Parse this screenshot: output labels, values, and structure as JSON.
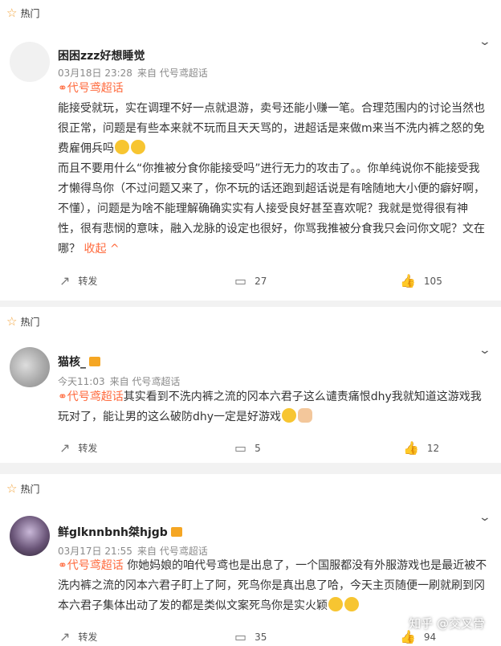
{
  "posts": [
    {
      "hot_label": "热门",
      "username": "困困zzz好想睡觉",
      "date": "03月18日 23:28",
      "source": "来自 代号鸢超话",
      "topic": "代号鸢超话",
      "text1": "能接受就玩，实在调理不好一点就退游，卖号还能小赚一笔。合理范围内的讨论当然也很正常，问题是有些本来就不玩而且天天骂的，进超话是来做m来当不洗内裤之怒的免费雇佣兵吗",
      "text2": "而且不要用什么“你推被分食你能接受吗”进行无力的攻击了。。你单纯说你不能接受我才懒得鸟你（不过问题又来了，你不玩的话还跑到超话说是有啥随地大小便的癖好啊，不懂），问题是为啥不能理解确确实实有人接受良好甚至喜欢呢？我就是觉得很有神性，很有悲悯的意味，融入龙脉的设定也很好，你骂我推被分食我只会问你文呢？文在哪？",
      "fold": "收起",
      "repost": "转发",
      "comments": "27",
      "likes": "105"
    },
    {
      "hot_label": "热门",
      "username": "猫核_",
      "date": "今天11:03",
      "source": "来自 代号鸢超话",
      "topic": "代号鸢超话",
      "text1": "其实看到不洗内裤之流的冈本六君子这么谴责痛恨dhy我就知道这游戏我玩对了，能让男的这么破防dhy一定是好游戏",
      "repost": "转发",
      "comments": "5",
      "likes": "12"
    },
    {
      "hot_label": "热门",
      "username": "鲜glknnbnh桀hjgb",
      "date": "03月17日 21:55",
      "source": "来自 代号鸢超话",
      "topic": "代号鸢超话",
      "text1": "你她妈娘的咱代号鸢也是出息了，一个国服都没有外服游戏也是最近被不洗内裤之流的冈本六君子盯上了阿，死鸟你是真出息了哈，今天主页随便一刷就刷到冈本六君子集体出动了发的都是类似文案死鸟你是实火颖",
      "repost": "转发",
      "comments": "35",
      "likes": "94"
    }
  ],
  "watermark": "知乎 @交叉骨"
}
